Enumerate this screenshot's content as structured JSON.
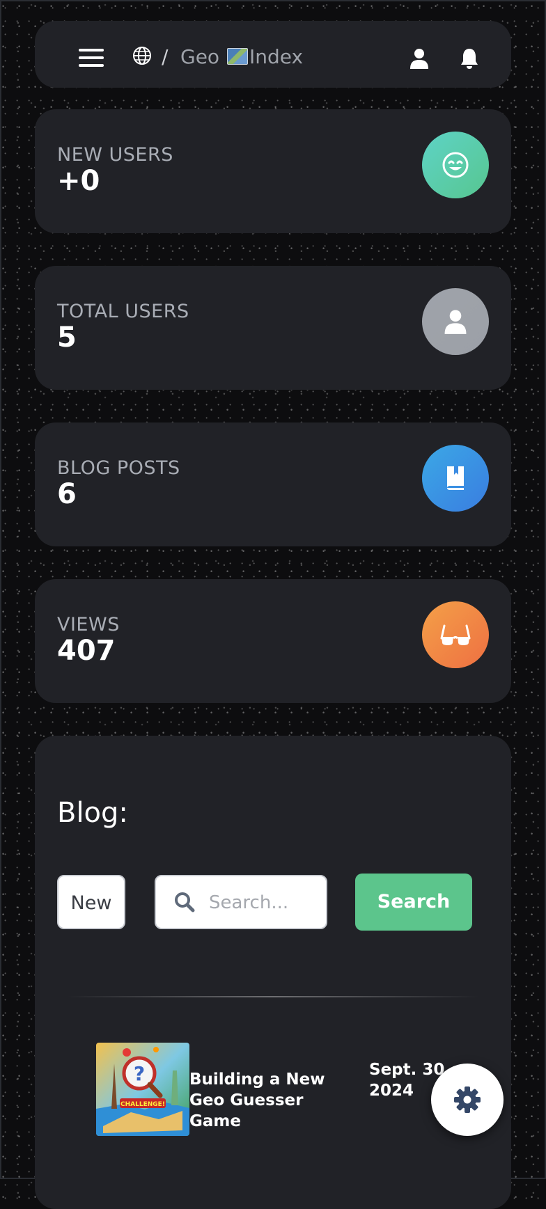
{
  "navbar": {
    "breadcrumb_separator": "/",
    "breadcrumb_title_part1": "Geo",
    "breadcrumb_title_part2": "Index",
    "icons": [
      "hamburger-menu-icon",
      "globe-icon",
      "map-emoji-icon",
      "user-icon",
      "bell-icon"
    ]
  },
  "stats": [
    {
      "label": "NEW USERS",
      "value": "+0",
      "icon": "smile-icon",
      "color": "#5ccfae"
    },
    {
      "label": "TOTAL USERS",
      "value": "5",
      "icon": "user-icon",
      "color": "#9ea2a9"
    },
    {
      "label": "BLOG POSTS",
      "value": "6",
      "icon": "book-icon",
      "color": "#3a93e3"
    },
    {
      "label": "VIEWS",
      "value": "407",
      "icon": "glasses-icon",
      "color": "#f08a45"
    }
  ],
  "blog": {
    "title": "Blog:",
    "filter_selected": "New",
    "search_placeholder": "Search...",
    "search_button": "Search",
    "posts": [
      {
        "title": "Building a New Geo Guesser Game",
        "date": "Sept. 30, 2024",
        "thumbnail_caption": "CHALLENGE!"
      }
    ]
  },
  "fab": {
    "icon": "gear-icon"
  },
  "colors": {
    "background": "#0d0d0f",
    "card": "#212227",
    "accent_green": "#5cc58c"
  }
}
